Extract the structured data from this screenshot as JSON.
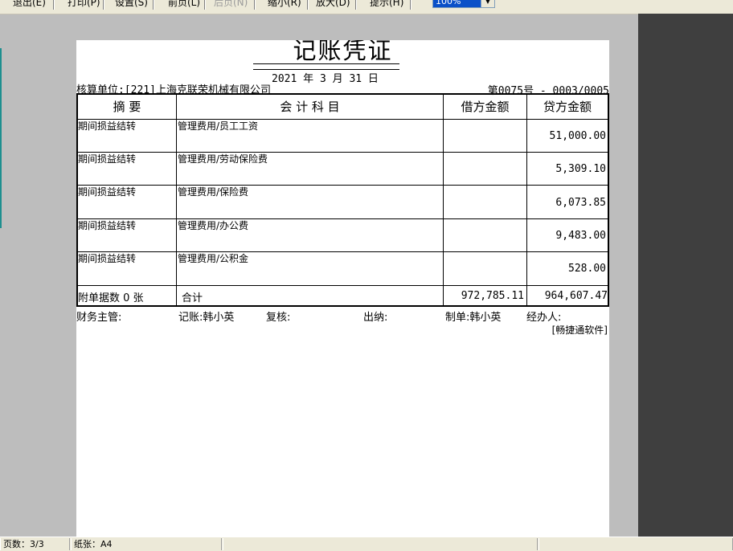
{
  "toolbar": {
    "exit": "退出(E)",
    "print": "打印(P)",
    "settings": "设置(S)",
    "prev_page": "前页(L)",
    "next_page": "后页(N)",
    "zoom_out": "缩小(R)",
    "zoom_in": "放大(D)",
    "hint": "提示(H)",
    "zoom_value": "100%"
  },
  "voucher": {
    "title": "记账凭证",
    "title_rule": "====================",
    "date": "2021 年  3  月 31 日",
    "unit": "核算单位:[221]上海克联荣机械有限公司",
    "number": "第0075号 - 0003/0005",
    "headers": {
      "summary": "摘    要",
      "account": "会  计  科  目",
      "debit": "借方金额",
      "credit": "贷方金额"
    },
    "rows": [
      {
        "summary": "期间损益结转",
        "account": "管理费用/员工工资",
        "debit": "",
        "credit": "51,000.00"
      },
      {
        "summary": "期间损益结转",
        "account": "管理费用/劳动保险费",
        "debit": "",
        "credit": "5,309.10"
      },
      {
        "summary": "期间损益结转",
        "account": "管理费用/保险费",
        "debit": "",
        "credit": "6,073.85"
      },
      {
        "summary": "期间损益结转",
        "account": "管理费用/办公费",
        "debit": "",
        "credit": "9,483.00"
      },
      {
        "summary": "期间损益结转",
        "account": "管理费用/公积金",
        "debit": "",
        "credit": "528.00"
      }
    ],
    "footer": {
      "attachments": "附单据数   0   张",
      "total_label": "合计",
      "debit_total": "972,785.11",
      "credit_total": "964,607.47"
    },
    "signatures": {
      "finance_manager": "财务主管:",
      "bookkeeper": "记账:韩小英",
      "reviewer": "复核:",
      "cashier": "出纳:",
      "preparer": "制单:韩小英",
      "handler": "经办人:"
    },
    "software": "[畅捷通软件]"
  },
  "status": {
    "pages": "页数：3/3",
    "paper": "纸张：A4"
  }
}
